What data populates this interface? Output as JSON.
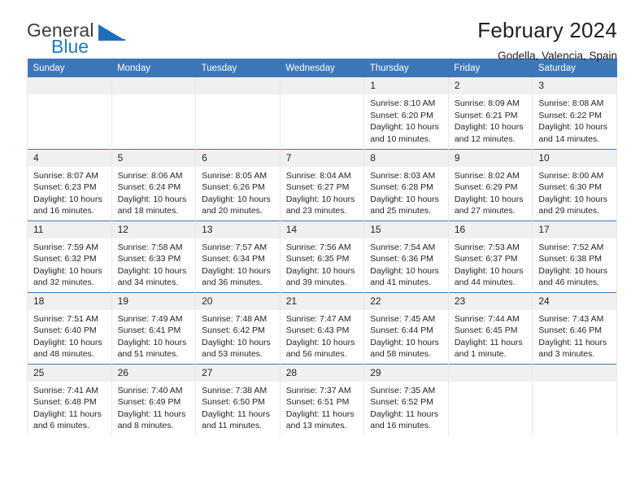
{
  "brand": {
    "name_top": "General",
    "name_bottom": "Blue",
    "triangle_color": "#1f6fb7",
    "text_color": "#3c3c3b",
    "blue_color": "#1f7bc1"
  },
  "header": {
    "title": "February 2024",
    "subtitle": "Godella, Valencia, Spain"
  },
  "theme": {
    "header_blue": "#3d77b8",
    "daynum_bg": "#f0f0f0",
    "grid_line": "#e8e8e8",
    "text": "#231f20"
  },
  "weekday_headers": [
    "Sunday",
    "Monday",
    "Tuesday",
    "Wednesday",
    "Thursday",
    "Friday",
    "Saturday"
  ],
  "weeks": [
    [
      {
        "day": "",
        "lines": []
      },
      {
        "day": "",
        "lines": []
      },
      {
        "day": "",
        "lines": []
      },
      {
        "day": "",
        "lines": []
      },
      {
        "day": "1",
        "lines": [
          "Sunrise: 8:10 AM",
          "Sunset: 6:20 PM",
          "Daylight: 10 hours",
          "and 10 minutes."
        ]
      },
      {
        "day": "2",
        "lines": [
          "Sunrise: 8:09 AM",
          "Sunset: 6:21 PM",
          "Daylight: 10 hours",
          "and 12 minutes."
        ]
      },
      {
        "day": "3",
        "lines": [
          "Sunrise: 8:08 AM",
          "Sunset: 6:22 PM",
          "Daylight: 10 hours",
          "and 14 minutes."
        ]
      }
    ],
    [
      {
        "day": "4",
        "lines": [
          "Sunrise: 8:07 AM",
          "Sunset: 6:23 PM",
          "Daylight: 10 hours",
          "and 16 minutes."
        ]
      },
      {
        "day": "5",
        "lines": [
          "Sunrise: 8:06 AM",
          "Sunset: 6:24 PM",
          "Daylight: 10 hours",
          "and 18 minutes."
        ]
      },
      {
        "day": "6",
        "lines": [
          "Sunrise: 8:05 AM",
          "Sunset: 6:26 PM",
          "Daylight: 10 hours",
          "and 20 minutes."
        ]
      },
      {
        "day": "7",
        "lines": [
          "Sunrise: 8:04 AM",
          "Sunset: 6:27 PM",
          "Daylight: 10 hours",
          "and 23 minutes."
        ]
      },
      {
        "day": "8",
        "lines": [
          "Sunrise: 8:03 AM",
          "Sunset: 6:28 PM",
          "Daylight: 10 hours",
          "and 25 minutes."
        ]
      },
      {
        "day": "9",
        "lines": [
          "Sunrise: 8:02 AM",
          "Sunset: 6:29 PM",
          "Daylight: 10 hours",
          "and 27 minutes."
        ]
      },
      {
        "day": "10",
        "lines": [
          "Sunrise: 8:00 AM",
          "Sunset: 6:30 PM",
          "Daylight: 10 hours",
          "and 29 minutes."
        ]
      }
    ],
    [
      {
        "day": "11",
        "lines": [
          "Sunrise: 7:59 AM",
          "Sunset: 6:32 PM",
          "Daylight: 10 hours",
          "and 32 minutes."
        ]
      },
      {
        "day": "12",
        "lines": [
          "Sunrise: 7:58 AM",
          "Sunset: 6:33 PM",
          "Daylight: 10 hours",
          "and 34 minutes."
        ]
      },
      {
        "day": "13",
        "lines": [
          "Sunrise: 7:57 AM",
          "Sunset: 6:34 PM",
          "Daylight: 10 hours",
          "and 36 minutes."
        ]
      },
      {
        "day": "14",
        "lines": [
          "Sunrise: 7:56 AM",
          "Sunset: 6:35 PM",
          "Daylight: 10 hours",
          "and 39 minutes."
        ]
      },
      {
        "day": "15",
        "lines": [
          "Sunrise: 7:54 AM",
          "Sunset: 6:36 PM",
          "Daylight: 10 hours",
          "and 41 minutes."
        ]
      },
      {
        "day": "16",
        "lines": [
          "Sunrise: 7:53 AM",
          "Sunset: 6:37 PM",
          "Daylight: 10 hours",
          "and 44 minutes."
        ]
      },
      {
        "day": "17",
        "lines": [
          "Sunrise: 7:52 AM",
          "Sunset: 6:38 PM",
          "Daylight: 10 hours",
          "and 46 minutes."
        ]
      }
    ],
    [
      {
        "day": "18",
        "lines": [
          "Sunrise: 7:51 AM",
          "Sunset: 6:40 PM",
          "Daylight: 10 hours",
          "and 48 minutes."
        ]
      },
      {
        "day": "19",
        "lines": [
          "Sunrise: 7:49 AM",
          "Sunset: 6:41 PM",
          "Daylight: 10 hours",
          "and 51 minutes."
        ]
      },
      {
        "day": "20",
        "lines": [
          "Sunrise: 7:48 AM",
          "Sunset: 6:42 PM",
          "Daylight: 10 hours",
          "and 53 minutes."
        ]
      },
      {
        "day": "21",
        "lines": [
          "Sunrise: 7:47 AM",
          "Sunset: 6:43 PM",
          "Daylight: 10 hours",
          "and 56 minutes."
        ]
      },
      {
        "day": "22",
        "lines": [
          "Sunrise: 7:45 AM",
          "Sunset: 6:44 PM",
          "Daylight: 10 hours",
          "and 58 minutes."
        ]
      },
      {
        "day": "23",
        "lines": [
          "Sunrise: 7:44 AM",
          "Sunset: 6:45 PM",
          "Daylight: 11 hours",
          "and 1 minute."
        ]
      },
      {
        "day": "24",
        "lines": [
          "Sunrise: 7:43 AM",
          "Sunset: 6:46 PM",
          "Daylight: 11 hours",
          "and 3 minutes."
        ]
      }
    ],
    [
      {
        "day": "25",
        "lines": [
          "Sunrise: 7:41 AM",
          "Sunset: 6:48 PM",
          "Daylight: 11 hours",
          "and 6 minutes."
        ]
      },
      {
        "day": "26",
        "lines": [
          "Sunrise: 7:40 AM",
          "Sunset: 6:49 PM",
          "Daylight: 11 hours",
          "and 8 minutes."
        ]
      },
      {
        "day": "27",
        "lines": [
          "Sunrise: 7:38 AM",
          "Sunset: 6:50 PM",
          "Daylight: 11 hours",
          "and 11 minutes."
        ]
      },
      {
        "day": "28",
        "lines": [
          "Sunrise: 7:37 AM",
          "Sunset: 6:51 PM",
          "Daylight: 11 hours",
          "and 13 minutes."
        ]
      },
      {
        "day": "29",
        "lines": [
          "Sunrise: 7:35 AM",
          "Sunset: 6:52 PM",
          "Daylight: 11 hours",
          "and 16 minutes."
        ]
      },
      {
        "day": "",
        "lines": []
      },
      {
        "day": "",
        "lines": []
      }
    ]
  ]
}
